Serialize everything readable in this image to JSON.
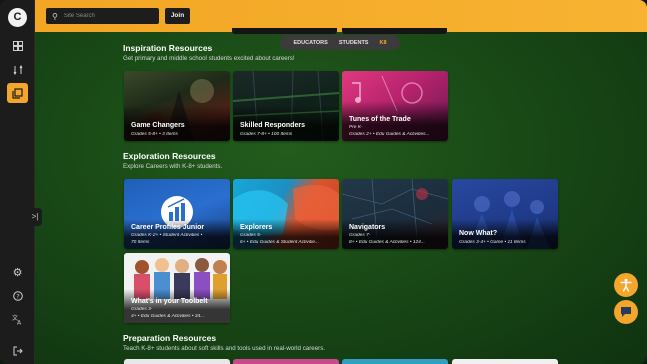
{
  "search": {
    "placeholder": "Site Search"
  },
  "header": {
    "join_label": "Join"
  },
  "audience_tabs": [
    "EDUCATORS",
    "STUDENTS",
    "K8"
  ],
  "sidebar": {
    "logo": "C",
    "icons": [
      "dashboard-icon",
      "tools-icon",
      "library-icon",
      "settings-icon",
      "help-icon",
      "translate-icon",
      "logout-icon"
    ]
  },
  "sections": [
    {
      "title": "Inspiration Resources",
      "subtitle": "Get primary and middle school students excited about careers!",
      "cards": [
        {
          "title": "Game Changers",
          "meta": "Grades 5-8+ • 3 Items"
        },
        {
          "title": "Skilled Responders",
          "meta": "Grades 7-8+ • 100 Items"
        },
        {
          "title": "Tunes of the Trade",
          "meta1": "Pre K-",
          "meta": "Grades 2+ • Edu Guides & Activities..."
        }
      ]
    },
    {
      "title": "Exploration Resources",
      "subtitle": "Explore Careers with K-8+ students.",
      "cards": [
        {
          "title": "Career Profiles Junior",
          "meta1": "Grades K-2+ • Student Activities •",
          "meta": "70 Items"
        },
        {
          "title": "Explorers",
          "meta1": "Grades 5-",
          "meta": "6+ • Edu Guides & Student Activitie..."
        },
        {
          "title": "Navigators",
          "meta1": "Grades 7-",
          "meta": "8+ • Edu Guides & Activities • 124..."
        },
        {
          "title": "Now What?",
          "meta": "Grades 3-4+ • Game • 11 Items"
        },
        {
          "title": "What's in your Toolbelt",
          "meta1": "Grades 3-",
          "meta": "4+ • Edu Guides & Activities • 34..."
        }
      ]
    },
    {
      "title": "Preparation Resources",
      "subtitle": "Teach K-8+ students about soft skills and tools used in real-world careers."
    }
  ],
  "colors": {
    "accent": "#f3a62b",
    "sidebar": "#1c1c1c",
    "background": "#194a16"
  }
}
